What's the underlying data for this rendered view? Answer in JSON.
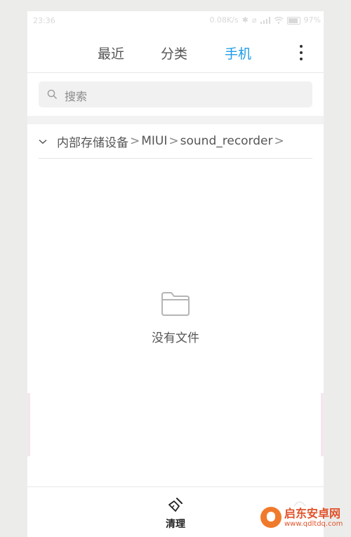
{
  "status_bar": {
    "time": "23:36",
    "network_speed": "0.08K/s",
    "bluetooth_icon": "bluetooth-icon",
    "silent_icon": "silent-icon",
    "battery_percent": "97%"
  },
  "tabs": [
    {
      "label": "最近",
      "active": false
    },
    {
      "label": "分类",
      "active": false
    },
    {
      "label": "手机",
      "active": true
    }
  ],
  "colors": {
    "accent": "#1e9be8",
    "text": "#555555"
  },
  "search": {
    "placeholder": "搜索",
    "icon": "search-icon"
  },
  "breadcrumb": {
    "items": [
      "内部存储设备",
      "MIUI",
      "sound_recorder"
    ],
    "separator": ">"
  },
  "empty_state": {
    "icon": "folder-icon",
    "message": "没有文件"
  },
  "bottom_bar": {
    "clean_label": "清理",
    "clean_icon": "broom-icon"
  },
  "watermark": {
    "name": "启东安卓网",
    "url": "www.qdltdq.com"
  }
}
